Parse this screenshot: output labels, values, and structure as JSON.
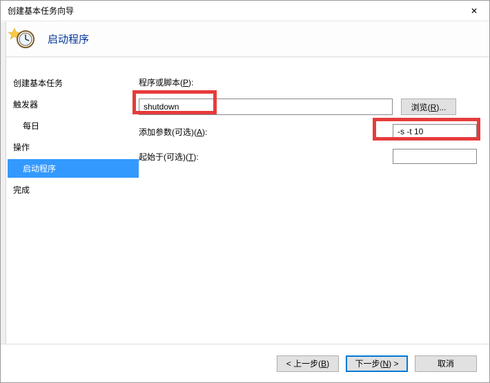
{
  "window": {
    "title": "创建基本任务向导",
    "close_glyph": "✕"
  },
  "header": {
    "title": "启动程序"
  },
  "sidebar": {
    "items": [
      {
        "label": "创建基本任务",
        "indent": false,
        "selected": false
      },
      {
        "label": "触发器",
        "indent": false,
        "selected": false
      },
      {
        "label": "每日",
        "indent": true,
        "selected": false
      },
      {
        "label": "操作",
        "indent": false,
        "selected": false
      },
      {
        "label": "启动程序",
        "indent": true,
        "selected": true
      },
      {
        "label": "完成",
        "indent": false,
        "selected": false
      }
    ]
  },
  "form": {
    "program_label_pre": "程序或脚本(",
    "program_label_key": "P",
    "program_label_post": "):",
    "program_value": "shutdown",
    "browse_pre": "浏览(",
    "browse_key": "R",
    "browse_post": ")...",
    "args_label_pre": "添加参数(可选)(",
    "args_label_key": "A",
    "args_label_post": "):",
    "args_value": "-s -t 10",
    "startin_label_pre": "起始于(可选)(",
    "startin_label_key": "T",
    "startin_label_post": "):",
    "startin_value": ""
  },
  "footer": {
    "back_pre": "< 上一步(",
    "back_key": "B",
    "back_post": ")",
    "next_pre": "下一步(",
    "next_key": "N",
    "next_post": ") >",
    "cancel": "取消"
  }
}
